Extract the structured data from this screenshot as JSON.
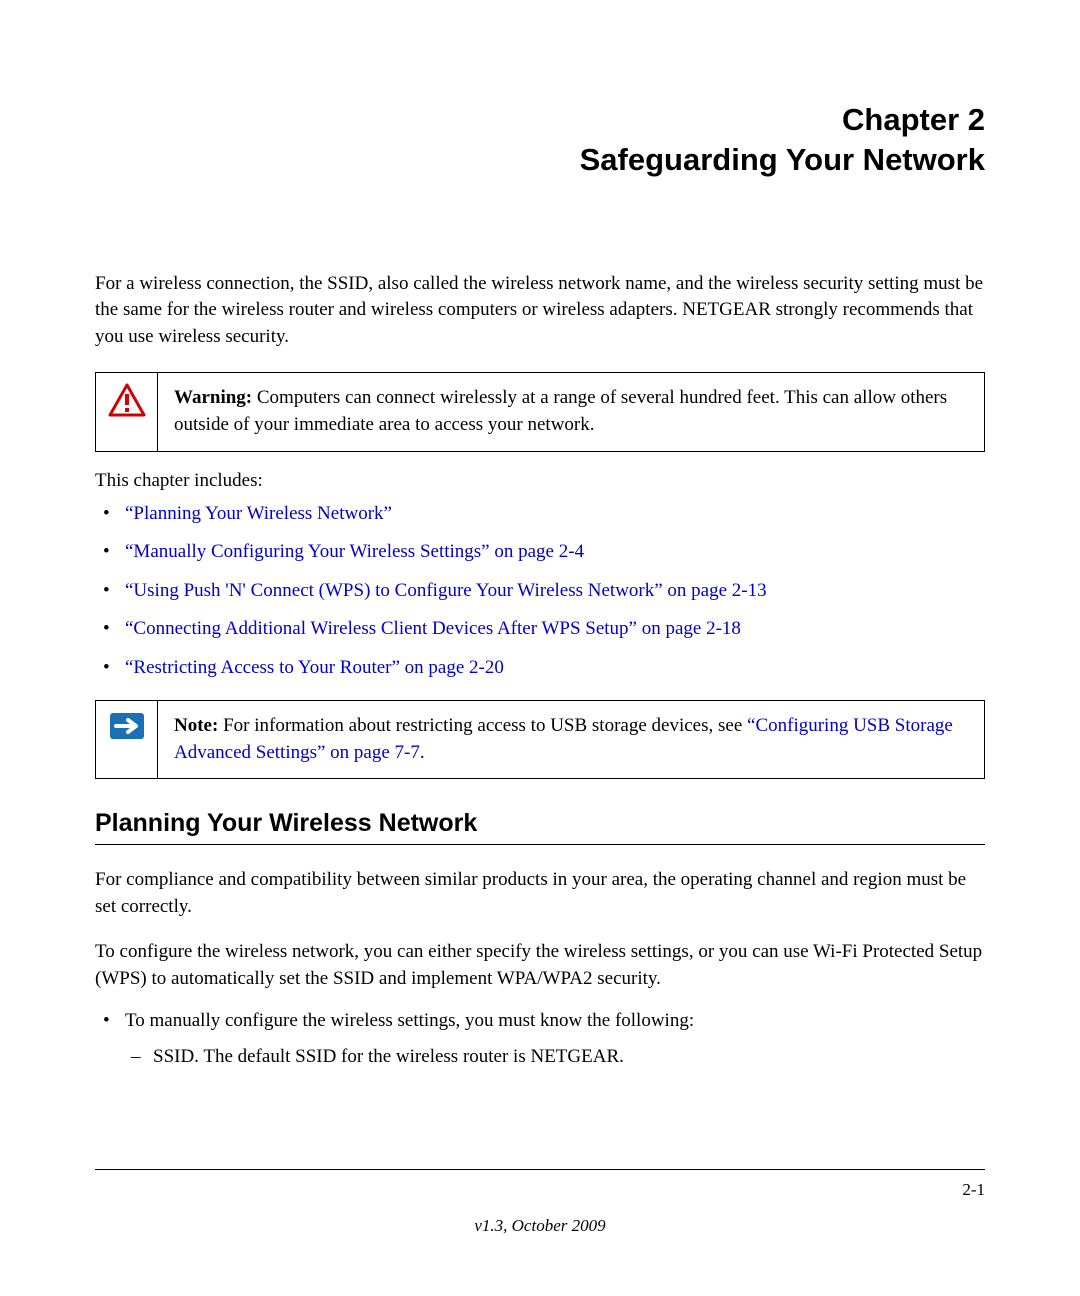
{
  "chapter": {
    "label": "Chapter 2",
    "title": "Safeguarding Your Network"
  },
  "intro": "For a wireless connection, the SSID, also called the wireless network name, and the wireless security setting must be the same for the wireless router and wireless computers or wireless adapters. NETGEAR strongly recommends that you use wireless security.",
  "warning": {
    "label": "Warning:",
    "text": " Computers can connect wirelessly at a range of several hundred feet. This can allow others outside of your immediate area to access your network."
  },
  "includes_label": "This chapter includes:",
  "toc": [
    "“Planning Your Wireless Network”",
    "“Manually Configuring Your Wireless Settings” on page 2-4",
    "“Using Push 'N' Connect (WPS) to Configure Your Wireless Network” on page 2-13",
    "“Connecting Additional Wireless Client Devices After WPS Setup” on page 2-18",
    "“Restricting Access to Your Router” on page 2-20"
  ],
  "note": {
    "label": "Note:",
    "text_before": " For information about restricting access to USB storage devices, see ",
    "link": "“Configuring USB Storage Advanced Settings” on page 7-7",
    "text_after": "."
  },
  "section_heading": "Planning Your Wireless Network",
  "para1": "For compliance and compatibility between similar products in your area, the operating channel and region must be set correctly.",
  "para2": "To configure the wireless network, you can either specify the wireless settings, or you can use Wi-Fi Protected Setup (WPS) to automatically set the SSID and implement WPA/WPA2 security.",
  "bullet1": "To manually configure the wireless settings, you must know the following:",
  "sub1": "SSID. The default SSID for the wireless router is NETGEAR.",
  "footer": {
    "page": "2-1",
    "version": "v1.3, October 2009"
  }
}
